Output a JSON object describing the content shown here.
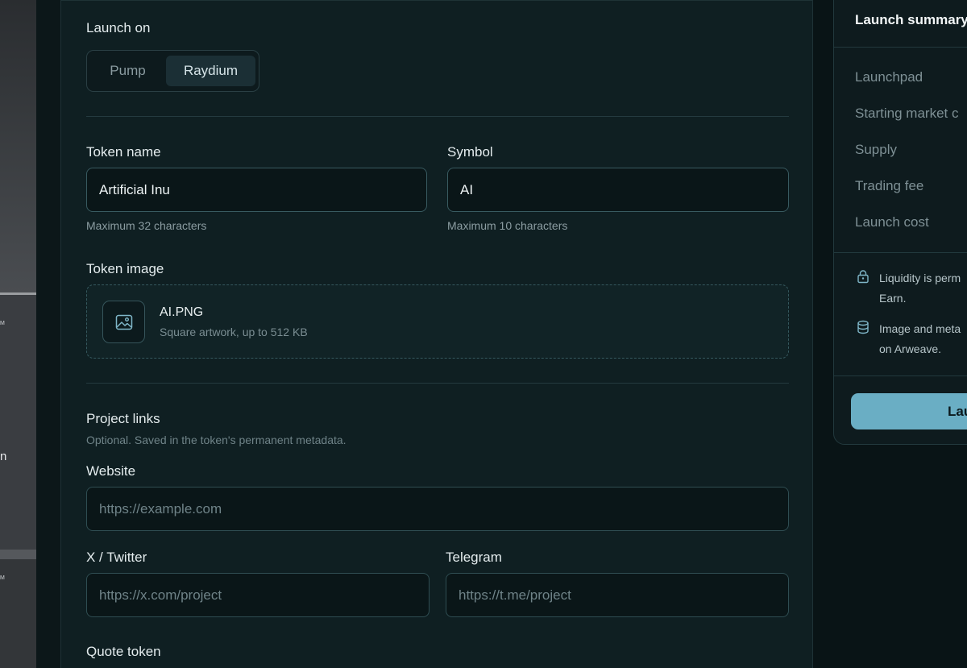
{
  "left_fragments": [
    "M",
    "n",
    "M"
  ],
  "launch_on": {
    "label": "Launch on",
    "options": [
      "Pump",
      "Raydium"
    ],
    "selected": "Raydium"
  },
  "token_name": {
    "label": "Token name",
    "value": "Artificial Inu",
    "helper": "Maximum 32 characters"
  },
  "symbol": {
    "label": "Symbol",
    "value": "AI",
    "helper": "Maximum 10 characters"
  },
  "token_image": {
    "label": "Token image",
    "filename": "AI.PNG",
    "hint": "Square artwork, up to 512 KB",
    "icon": "image-icon"
  },
  "project_links": {
    "title": "Project links",
    "subtitle": "Optional. Saved in the token's permanent metadata.",
    "website_label": "Website",
    "website_placeholder": "https://example.com",
    "twitter_label": "X / Twitter",
    "twitter_placeholder": "https://x.com/project",
    "telegram_label": "Telegram",
    "telegram_placeholder": "https://t.me/project"
  },
  "quote_token": {
    "label": "Quote token"
  },
  "summary": {
    "title": "Launch summary",
    "rows": [
      "Launchpad",
      "Starting market c",
      "Supply",
      "Trading fee",
      "Launch cost"
    ],
    "notes": [
      {
        "icon": "lock-icon",
        "line1": "Liquidity is perm",
        "line2": "Earn."
      },
      {
        "icon": "database-icon",
        "line1": "Image and meta",
        "line2": "on Arweave."
      }
    ],
    "button_label": "Lau"
  },
  "colors": {
    "accent": "#6aaec4",
    "background": "#091416",
    "card": "#0f1f22"
  }
}
